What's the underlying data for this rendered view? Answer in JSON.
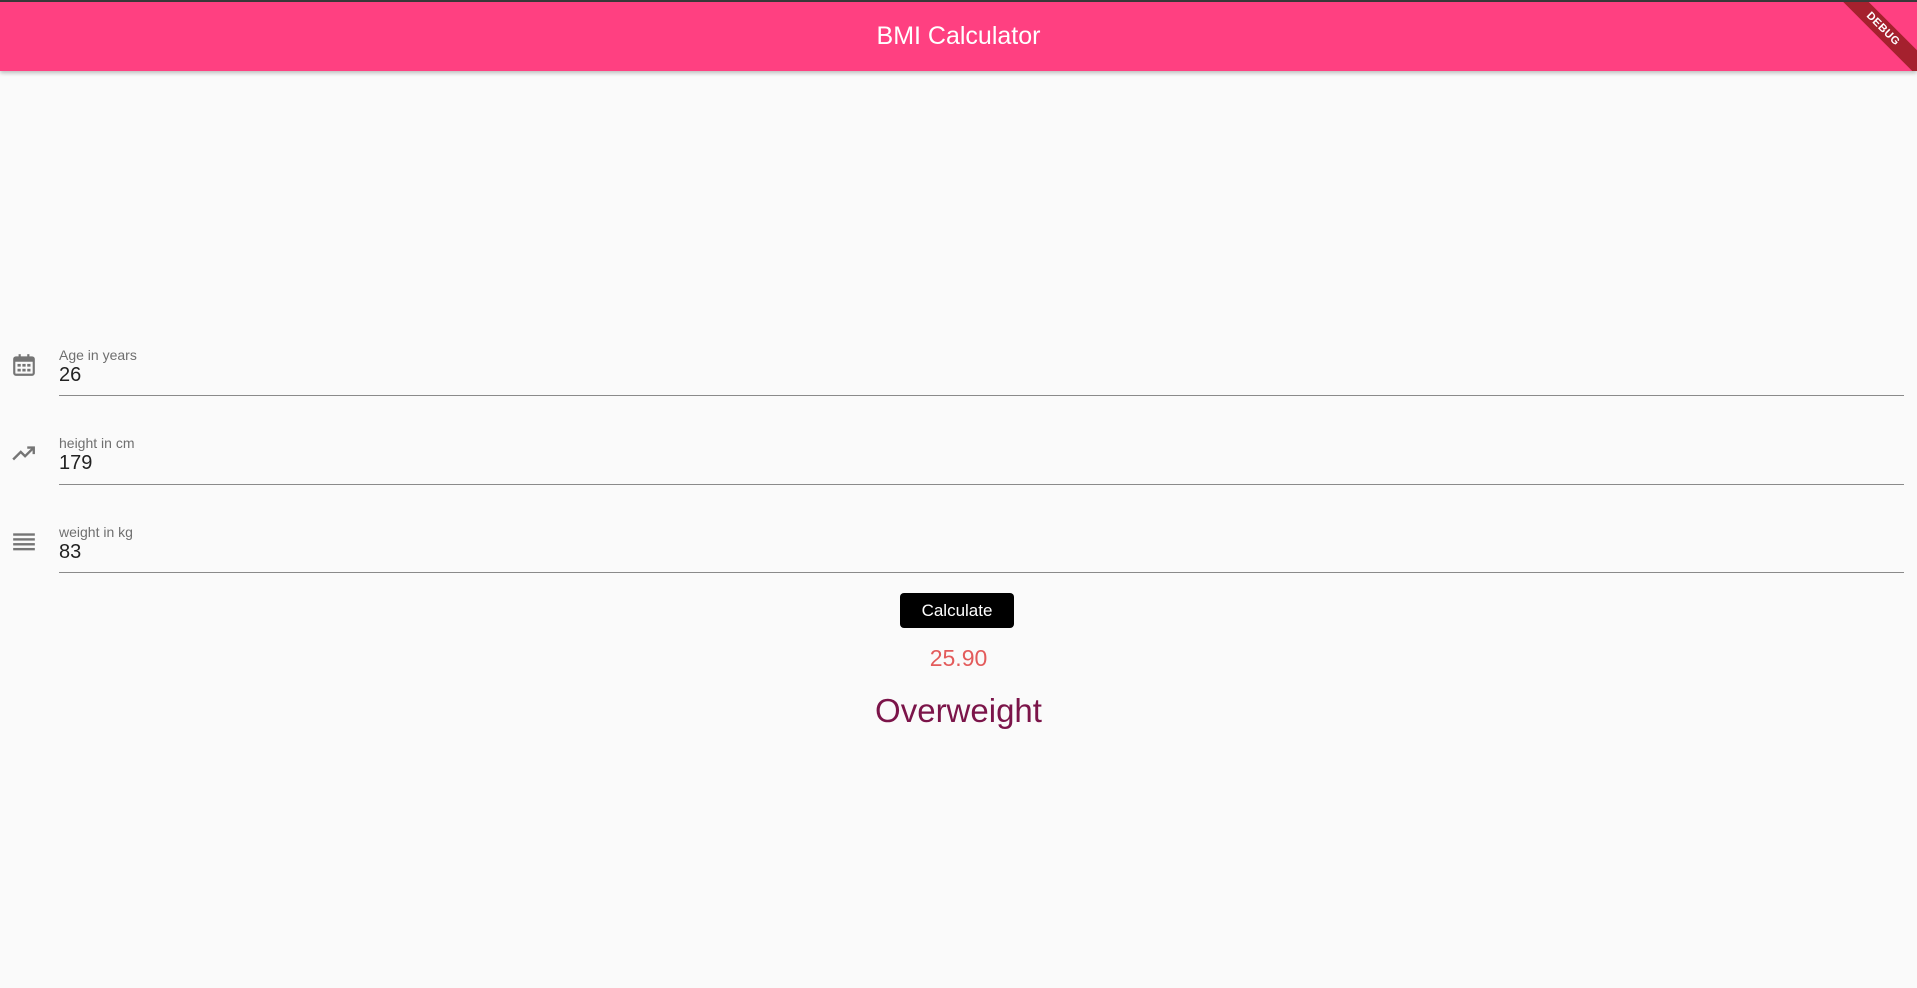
{
  "app": {
    "title": "BMI Calculator",
    "debug_banner": "DEBUG"
  },
  "colors": {
    "appbar": "#ff4081",
    "button": "#000000",
    "bmi_value": "#e35b5b",
    "bmi_category": "#7b1449"
  },
  "form": {
    "age": {
      "label": "Age in years",
      "value": "26",
      "icon": "calendar-icon"
    },
    "height": {
      "label": "height in cm",
      "value": "179",
      "icon": "trending-up-icon"
    },
    "weight": {
      "label": "weight in kg",
      "value": "83",
      "icon": "lines-icon"
    },
    "calculate_label": "Calculate"
  },
  "result": {
    "bmi": "25.90",
    "category": "Overweight"
  }
}
